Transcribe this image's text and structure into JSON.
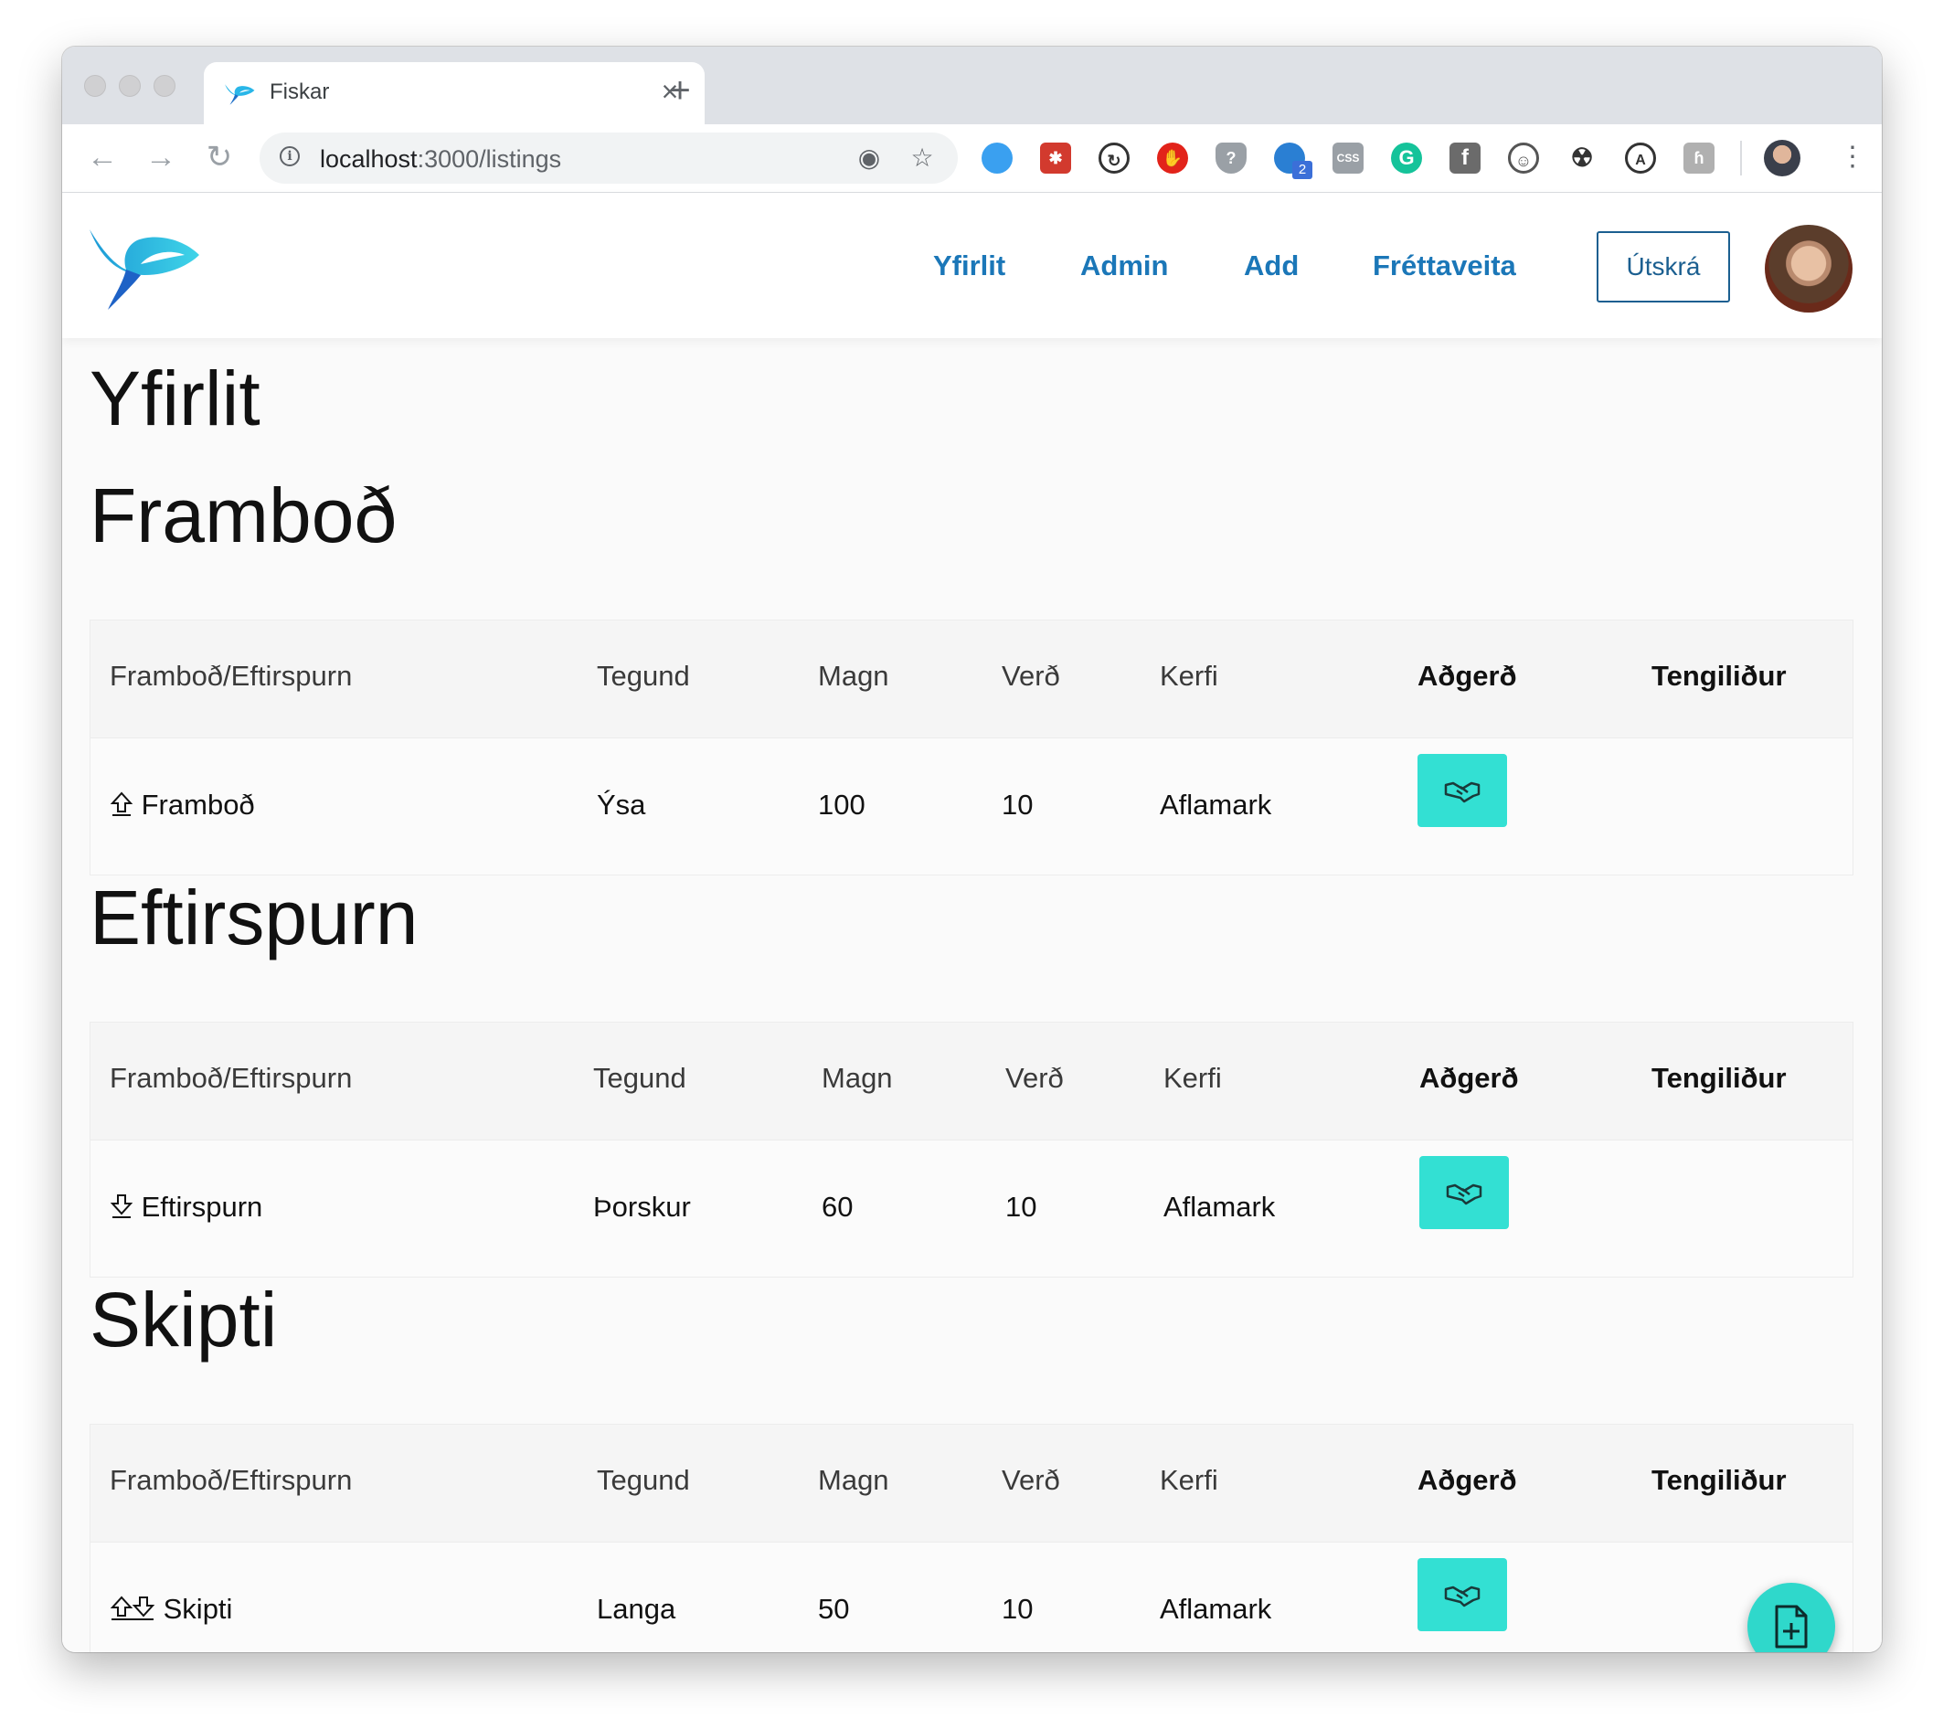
{
  "browser": {
    "tab_title": "Fiskar",
    "url_host": "localhost",
    "url_rest": ":3000/listings",
    "extension_badge": "2",
    "extension_css_label": "CSS"
  },
  "nav": {
    "links": [
      "Yfirlit",
      "Admin",
      "Add",
      "Fréttaveita"
    ],
    "logout_label": "Útskrá"
  },
  "page_title": "Yfirlit",
  "columns": [
    "Framboð/Eftirspurn",
    "Tegund",
    "Magn",
    "Verð",
    "Kerfi",
    "Aðgerð",
    "Tengiliður"
  ],
  "sections": [
    {
      "title": "Framboð",
      "row": {
        "type_icon": "arrow-up-icon",
        "kind": "Framboð",
        "species": "Ýsa",
        "quantity": "100",
        "price": "10",
        "system": "Aflamark"
      }
    },
    {
      "title": "Eftirspurn",
      "row": {
        "type_icon": "arrow-down-icon",
        "kind": "Eftirspurn",
        "species": "Þorskur",
        "quantity": "60",
        "price": "10",
        "system": "Aflamark"
      }
    },
    {
      "title": "Skipti",
      "row": {
        "type_icon": "swap-icon",
        "kind": "Skipti",
        "species": "Langa",
        "quantity": "50",
        "price": "10",
        "system": "Aflamark"
      }
    }
  ],
  "action_icon": "handshake-icon",
  "fab_icon": "add-document-icon",
  "colors": {
    "nav_link": "#1b77b8",
    "action_button": "#33e0d3",
    "fab": "#2fd8cb"
  }
}
